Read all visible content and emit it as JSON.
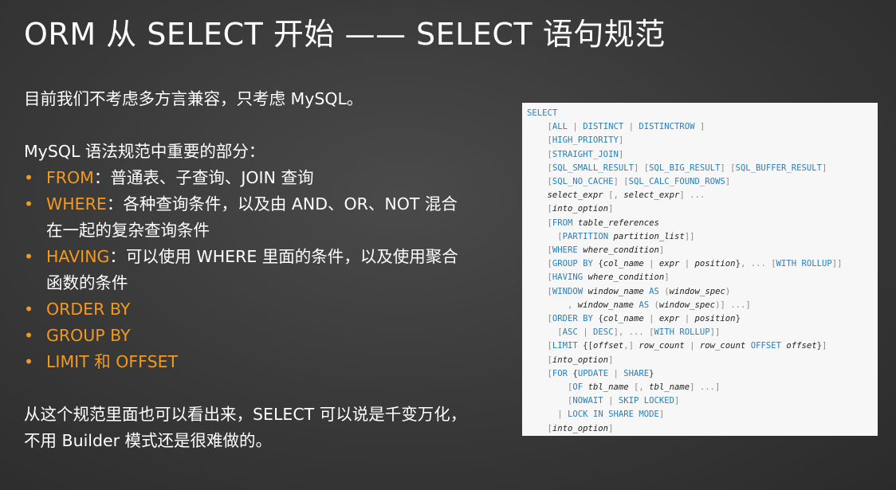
{
  "slide": {
    "title": "ORM 从 SELECT 开始 —— SELECT 语句规范",
    "intro": "目前我们不考虑多方言兼容，只考虑 MySQL。",
    "subheading": "MySQL 语法规范中重要的部分：",
    "bullets": [
      {
        "keyword": "FROM",
        "text": "：普通表、子查询、JOIN 查询"
      },
      {
        "keyword": "WHERE",
        "text": "：各种查询条件，以及由 AND、OR、NOT 混合在一起的复杂查询条件"
      },
      {
        "keyword": "HAVING",
        "text": "：可以使用 WHERE 里面的条件，以及使用聚合函数的条件"
      },
      {
        "keyword": "ORDER BY",
        "text": ""
      },
      {
        "keyword": "GROUP BY",
        "text": ""
      },
      {
        "keyword": "LIMIT 和 OFFSET",
        "text": ""
      }
    ],
    "conclusion": "从这个规范里面也可以看出来，SELECT 可以说是千变万化，不用 Builder 模式还是很难做的。"
  },
  "syntax_lines": [
    [
      [
        "k",
        "SELECT"
      ]
    ],
    [
      [
        "p",
        "    "
      ],
      [
        "b",
        "["
      ],
      [
        "k",
        "ALL"
      ],
      [
        "b",
        " | "
      ],
      [
        "k",
        "DISTINCT"
      ],
      [
        "b",
        " | "
      ],
      [
        "k",
        "DISTINCTROW"
      ],
      [
        "b",
        " ]"
      ]
    ],
    [
      [
        "p",
        "    "
      ],
      [
        "b",
        "["
      ],
      [
        "k",
        "HIGH_PRIORITY"
      ],
      [
        "b",
        "]"
      ]
    ],
    [
      [
        "p",
        "    "
      ],
      [
        "b",
        "["
      ],
      [
        "k",
        "STRAIGHT_JOIN"
      ],
      [
        "b",
        "]"
      ]
    ],
    [
      [
        "p",
        "    "
      ],
      [
        "b",
        "["
      ],
      [
        "k",
        "SQL_SMALL_RESULT"
      ],
      [
        "b",
        "] ["
      ],
      [
        "k",
        "SQL_BIG_RESULT"
      ],
      [
        "b",
        "] ["
      ],
      [
        "k",
        "SQL_BUFFER_RESULT"
      ],
      [
        "b",
        "]"
      ]
    ],
    [
      [
        "p",
        "    "
      ],
      [
        "b",
        "["
      ],
      [
        "k",
        "SQL_NO_CACHE"
      ],
      [
        "b",
        "] ["
      ],
      [
        "k",
        "SQL_CALC_FOUND_ROWS"
      ],
      [
        "b",
        "]"
      ]
    ],
    [
      [
        "p",
        "    "
      ],
      [
        "i",
        "select_expr"
      ],
      [
        "b",
        " [, "
      ],
      [
        "i",
        "select_expr"
      ],
      [
        "b",
        "] ..."
      ]
    ],
    [
      [
        "p",
        "    "
      ],
      [
        "b",
        "["
      ],
      [
        "i",
        "into_option"
      ],
      [
        "b",
        "]"
      ]
    ],
    [
      [
        "p",
        "    "
      ],
      [
        "b",
        "["
      ],
      [
        "k",
        "FROM"
      ],
      [
        "p",
        " "
      ],
      [
        "i",
        "table_references"
      ]
    ],
    [
      [
        "p",
        "      "
      ],
      [
        "b",
        "["
      ],
      [
        "k",
        "PARTITION"
      ],
      [
        "p",
        " "
      ],
      [
        "i",
        "partition_list"
      ],
      [
        "b",
        "]]"
      ]
    ],
    [
      [
        "p",
        "    "
      ],
      [
        "b",
        "["
      ],
      [
        "k",
        "WHERE"
      ],
      [
        "p",
        " "
      ],
      [
        "i",
        "where_condition"
      ],
      [
        "b",
        "]"
      ]
    ],
    [
      [
        "p",
        "    "
      ],
      [
        "b",
        "["
      ],
      [
        "k",
        "GROUP BY"
      ],
      [
        "p",
        " {"
      ],
      [
        "i",
        "col_name"
      ],
      [
        "b",
        " | "
      ],
      [
        "i",
        "expr"
      ],
      [
        "b",
        " | "
      ],
      [
        "i",
        "position"
      ],
      [
        "p",
        "}"
      ],
      [
        "b",
        ", ... ["
      ],
      [
        "k",
        "WITH ROLLUP"
      ],
      [
        "b",
        "]]"
      ]
    ],
    [
      [
        "p",
        "    "
      ],
      [
        "b",
        "["
      ],
      [
        "k",
        "HAVING"
      ],
      [
        "p",
        " "
      ],
      [
        "i",
        "where_condition"
      ],
      [
        "b",
        "]"
      ]
    ],
    [
      [
        "p",
        "    "
      ],
      [
        "b",
        "["
      ],
      [
        "k",
        "WINDOW"
      ],
      [
        "p",
        " "
      ],
      [
        "i",
        "window_name"
      ],
      [
        "p",
        " "
      ],
      [
        "k",
        "AS"
      ],
      [
        "b",
        " ("
      ],
      [
        "i",
        "window_spec"
      ],
      [
        "b",
        ")"
      ]
    ],
    [
      [
        "p",
        "        "
      ],
      [
        "b",
        ", "
      ],
      [
        "i",
        "window_name"
      ],
      [
        "p",
        " "
      ],
      [
        "k",
        "AS"
      ],
      [
        "b",
        " ("
      ],
      [
        "i",
        "window_spec"
      ],
      [
        "b",
        ")] ...]"
      ]
    ],
    [
      [
        "p",
        "    "
      ],
      [
        "b",
        "["
      ],
      [
        "k",
        "ORDER BY"
      ],
      [
        "p",
        " {"
      ],
      [
        "i",
        "col_name"
      ],
      [
        "b",
        " | "
      ],
      [
        "i",
        "expr"
      ],
      [
        "b",
        " | "
      ],
      [
        "i",
        "position"
      ],
      [
        "p",
        "}"
      ]
    ],
    [
      [
        "p",
        "      "
      ],
      [
        "b",
        "["
      ],
      [
        "k",
        "ASC"
      ],
      [
        "b",
        " | "
      ],
      [
        "k",
        "DESC"
      ],
      [
        "b",
        "], ... ["
      ],
      [
        "k",
        "WITH ROLLUP"
      ],
      [
        "b",
        "]]"
      ]
    ],
    [
      [
        "p",
        "    "
      ],
      [
        "b",
        "["
      ],
      [
        "k",
        "LIMIT"
      ],
      [
        "p",
        " {["
      ],
      [
        "i",
        "offset"
      ],
      [
        "b",
        ",] "
      ],
      [
        "i",
        "row_count"
      ],
      [
        "b",
        " | "
      ],
      [
        "i",
        "row_count"
      ],
      [
        "p",
        " "
      ],
      [
        "k",
        "OFFSET"
      ],
      [
        "p",
        " "
      ],
      [
        "i",
        "offset"
      ],
      [
        "p",
        "}"
      ],
      [
        "b",
        "]"
      ]
    ],
    [
      [
        "p",
        "    "
      ],
      [
        "b",
        "["
      ],
      [
        "i",
        "into_option"
      ],
      [
        "b",
        "]"
      ]
    ],
    [
      [
        "p",
        "    "
      ],
      [
        "b",
        "["
      ],
      [
        "k",
        "FOR"
      ],
      [
        "p",
        " {"
      ],
      [
        "k",
        "UPDATE"
      ],
      [
        "b",
        " | "
      ],
      [
        "k",
        "SHARE"
      ],
      [
        "p",
        "}"
      ]
    ],
    [
      [
        "p",
        "        "
      ],
      [
        "b",
        "["
      ],
      [
        "k",
        "OF"
      ],
      [
        "p",
        " "
      ],
      [
        "i",
        "tbl_name"
      ],
      [
        "b",
        " [, "
      ],
      [
        "i",
        "tbl_name"
      ],
      [
        "b",
        "] ...]"
      ]
    ],
    [
      [
        "p",
        "        "
      ],
      [
        "b",
        "["
      ],
      [
        "k",
        "NOWAIT"
      ],
      [
        "b",
        " | "
      ],
      [
        "k",
        "SKIP LOCKED"
      ],
      [
        "b",
        "]"
      ]
    ],
    [
      [
        "p",
        "      "
      ],
      [
        "b",
        "| "
      ],
      [
        "k",
        "LOCK IN SHARE MODE"
      ],
      [
        "b",
        "]"
      ]
    ],
    [
      [
        "p",
        "    "
      ],
      [
        "b",
        "["
      ],
      [
        "i",
        "into_option"
      ],
      [
        "b",
        "]"
      ]
    ]
  ]
}
